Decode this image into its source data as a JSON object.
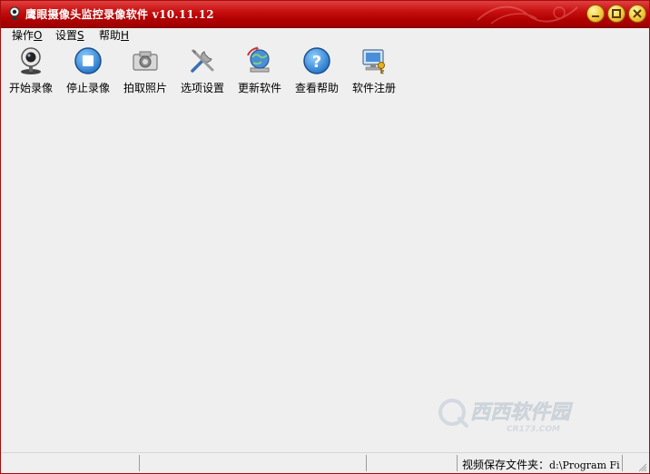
{
  "window": {
    "title": "鹰眼摄像头监控录像软件 v10.11.12",
    "accent": "#c00000"
  },
  "menu": {
    "items": [
      {
        "label": "操作",
        "key": "O"
      },
      {
        "label": "设置",
        "key": "S"
      },
      {
        "label": "帮助",
        "key": "H"
      }
    ]
  },
  "toolbar": {
    "buttons": [
      {
        "label": "开始录像",
        "icon": "webcam-icon"
      },
      {
        "label": "停止录像",
        "icon": "stop-icon"
      },
      {
        "label": "拍取照片",
        "icon": "camera-icon"
      },
      {
        "label": "选项设置",
        "icon": "tools-icon"
      },
      {
        "label": "更新软件",
        "icon": "update-globe-icon"
      },
      {
        "label": "查看帮助",
        "icon": "help-icon"
      },
      {
        "label": "软件注册",
        "icon": "register-key-icon"
      }
    ]
  },
  "watermark": {
    "text": "西西软件园",
    "subtext": "CR173.COM"
  },
  "statusbar": {
    "folder_label": "视频保存文件夹：",
    "folder_path": "d:\\Program Fi"
  }
}
